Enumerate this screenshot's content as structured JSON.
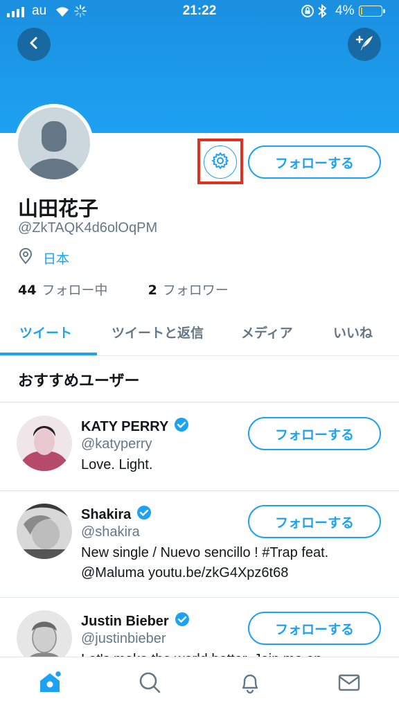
{
  "status_bar": {
    "carrier": "au",
    "time": "21:22",
    "battery_percent": "4%"
  },
  "header": {
    "back_icon": "chevron-left-icon",
    "compose_icon": "compose-tweet-icon"
  },
  "profile": {
    "name": "山田花子",
    "handle": "@ZkTAQK4d6olOqPM",
    "location": "日本",
    "following_count": "44",
    "following_label": "フォロー中",
    "followers_count": "2",
    "followers_label": "フォロワー",
    "follow_label": "フォローする",
    "settings_icon": "gear-icon"
  },
  "tabs": [
    {
      "label": "ツイート",
      "active": true
    },
    {
      "label": "ツイートと返信",
      "active": false
    },
    {
      "label": "メディア",
      "active": false
    },
    {
      "label": "いいね",
      "active": false
    }
  ],
  "recommended": {
    "title": "おすすめユーザー",
    "users": [
      {
        "name": "KATY PERRY",
        "handle": "@katyperry",
        "bio": "Love. Light.",
        "verified": true,
        "follow_label": "フォローする"
      },
      {
        "name": "Shakira",
        "handle": "@shakira",
        "bio": "New single / Nuevo sencillo ! #Trap feat. @Maluma youtu.be/zkG4Xpz6t68",
        "verified": true,
        "follow_label": "フォローする"
      },
      {
        "name": "Justin Bieber",
        "handle": "@justinbieber",
        "bio": "Let's make the world better. Join me on",
        "verified": true,
        "follow_label": "フォローする"
      }
    ]
  },
  "bottom_nav": [
    {
      "icon": "home-icon",
      "active": true
    },
    {
      "icon": "search-icon",
      "active": false
    },
    {
      "icon": "bell-icon",
      "active": false
    },
    {
      "icon": "mail-icon",
      "active": false
    }
  ],
  "colors": {
    "accent": "#1da1f2",
    "highlight": "#e0301e"
  }
}
